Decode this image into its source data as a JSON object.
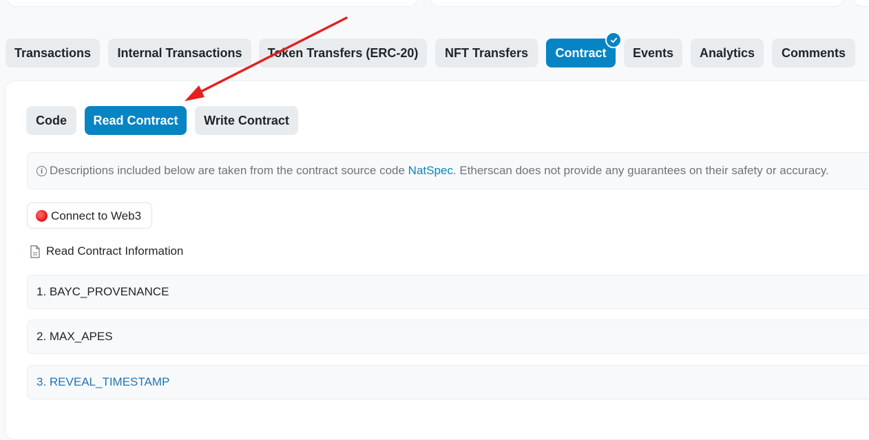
{
  "tabs": [
    {
      "label": "Transactions",
      "active": false
    },
    {
      "label": "Internal Transactions",
      "active": false
    },
    {
      "label": "Token Transfers (ERC-20)",
      "active": false
    },
    {
      "label": "NFT Transfers",
      "active": false
    },
    {
      "label": "Contract",
      "active": true,
      "verified": true
    },
    {
      "label": "Events",
      "active": false
    },
    {
      "label": "Analytics",
      "active": false
    },
    {
      "label": "Comments",
      "active": false
    }
  ],
  "subtabs": [
    {
      "label": "Code",
      "active": false
    },
    {
      "label": "Read Contract",
      "active": true
    },
    {
      "label": "Write Contract",
      "active": false
    }
  ],
  "notice": {
    "prefix": "Descriptions included below are taken from the contract source code",
    "link": "NatSpec",
    "suffix": ". Etherscan does not provide any guarantees on their safety or accuracy."
  },
  "connect": {
    "label": "Connect to Web3",
    "status_color": "#e31b1b"
  },
  "section_title": "Read Contract Information",
  "functions": [
    {
      "label": "1. BAYC_PROVENANCE"
    },
    {
      "label": "2. MAX_APES"
    },
    {
      "label": "3. REVEAL_TIMESTAMP"
    }
  ],
  "colors": {
    "accent": "#0784c3",
    "annotation_arrow": "#e32020"
  }
}
